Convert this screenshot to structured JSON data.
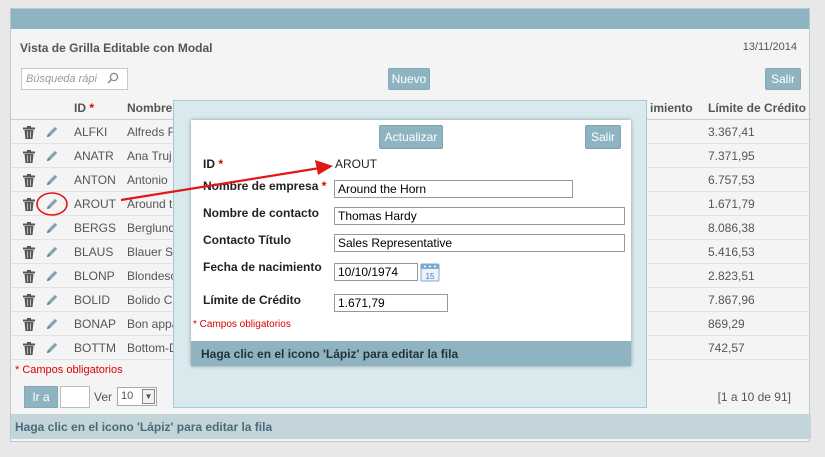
{
  "background": {
    "title": "Vista de Grilla Editable con Modal",
    "date": "13/11/2014",
    "search_placeholder": "Búsqueda rápi",
    "new_button": "Nuevo",
    "exit_button": "Salir",
    "columns": {
      "id": "ID",
      "id_required_mark": "*",
      "name": "Nombre",
      "birth_partial": "imiento",
      "credit_limit": "Límite de Crédito"
    },
    "rows": [
      {
        "id": "ALFKI",
        "name": "Alfreds F",
        "limit": "3.367,41"
      },
      {
        "id": "ANATR",
        "name": "Ana Truj",
        "limit": "7.371,95"
      },
      {
        "id": "ANTON",
        "name": "Antonio",
        "limit": "6.757,53"
      },
      {
        "id": "AROUT",
        "name": "Around t",
        "limit": "1.671,79"
      },
      {
        "id": "BERGS",
        "name": "Berglund",
        "limit": "8.086,38"
      },
      {
        "id": "BLAUS",
        "name": "Blauer S",
        "limit": "5.416,53"
      },
      {
        "id": "BLONP",
        "name": "Blondesc",
        "limit": "2.823,51"
      },
      {
        "id": "BOLID",
        "name": "Bolido C",
        "limit": "7.867,96"
      },
      {
        "id": "BONAP",
        "name": "Bon appa",
        "limit": "869,29"
      },
      {
        "id": "BOTTM",
        "name": "Bottom-D",
        "limit": "742,57"
      }
    ],
    "required_note": "* Campos obligatorios",
    "goto_button": "Ir a",
    "view_label": "Ver",
    "rows_per_page": "10",
    "range_text": "[1 a 10 de 91]",
    "footer_hint": "Haga clic en el icono 'Lápiz' para editar la fila",
    "accent_color": "#8fb4c1"
  },
  "modal": {
    "update_button": "Actualizar",
    "exit_button": "Salir",
    "fields": {
      "id_label": "ID",
      "id_value": "AROUT",
      "company_label": "Nombre de empresa",
      "company_value": "Around the Horn",
      "contact_label": "Nombre de contacto",
      "contact_value": "Thomas Hardy",
      "title_label": "Contacto Título",
      "title_value": "Sales Representative",
      "birth_label": "Fecha de nacimiento",
      "birth_value": "10/10/1974",
      "calendar_day": "15",
      "limit_label": "Límite de Crédito",
      "limit_value": "1.671,79"
    },
    "required_mark": "*",
    "required_note": "* Campos obligatorios",
    "footer_hint": "Haga clic en el icono 'Lápiz' para editar la fila"
  }
}
